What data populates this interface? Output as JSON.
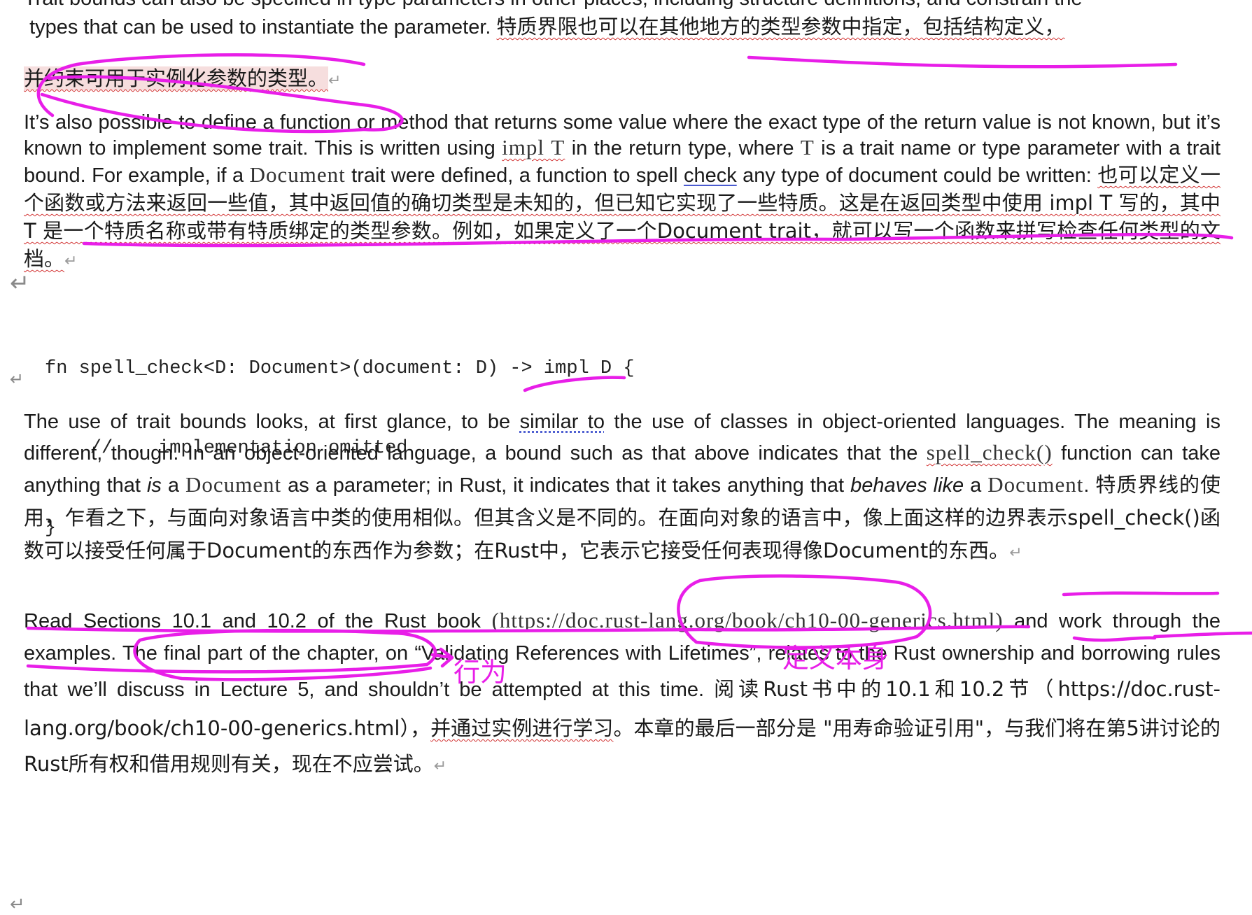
{
  "p1": {
    "line_top": "Trait bounds can also be specified in type parameters in other places, including structure definitions, and constrain the",
    "line_en": "types that can be used to instantiate the parameter. ",
    "zh_a": "特质界限也可以在其他地方的类型参数中指定，包括结构定义，",
    "zh_b": "并约束可用于实例化参数的类型。"
  },
  "p2": {
    "t1": "It’s also possible to define a function or method that returns some value where the exact type of the return value is not known, but it’s known to implement some trait. This is written using ",
    "impl_t": "impl T",
    "t2": " in the return type, where ",
    "t_code": "T",
    "t3": " is a trait name or type parameter with a trait bound. For example, if a ",
    "doc_code": "Document",
    "t4": " trait were defined, a function to spell ",
    "check_word": "check",
    "t5": " any type of document could be written: ",
    "zh": "也可以定义一个函数或方法来返回一些值，其中返回值的确切类型是未知的，但已知它实现了一些特质。这是在返回类型中使用 impl T 写的，其中 T 是一个特质名称或带有特质绑定的类型参数。例如，如果定义了一个Document trait，就可以写一个函数来拼写检查任何类型的文档。"
  },
  "code": {
    "line1": "fn spell_check<D: Document>(document: D) -> impl D {",
    "line2": "    // .. implementation omitted",
    "line3": "}"
  },
  "p3": {
    "t1": "The use of trait bounds looks, at first glance, to be ",
    "similar_to": "similar to",
    "t2": " the use of classes in object-oriented languages. The meaning is different, though. In an object-oriented language, a bound such as that above indicates that the ",
    "spell_code": "spell_check()",
    "t3": " function can take anything that ",
    "is_word": "is",
    "t4": " a ",
    "doc_code": "Document",
    "t5": " as a parameter; in Rust, it indicates that it takes anything that ",
    "behaves_like": "behaves like",
    "t6": " a ",
    "t7": ". ",
    "zh": "特质界线的使用，乍看之下，与面向对象语言中类的使用相似。但其含义是不同的。在面向对象的语言中，像上面这样的边界表示spell_check()函数可以接受任何属于Document的东西作为参数；在Rust中，它表示它接受任何表现得像Document的东西。"
  },
  "p4": {
    "t1": "Read Sections 10.1 and 10.2 of the Rust ",
    "book": "book",
    "url": "(https://doc.rust-lang.org/book/ch10-00-generics.html)",
    "t2": " and work through the examples. The final part of the chapter, on “Validating References with Lifetimes”, relates to the Rust ownership and borrowing rules that we’ll discuss in Lecture 5, and shouldn’t be attempted at this time. ",
    "zh_a": "阅读Rust书中的10.1和10.2节（https://doc.rust-lang.org/book/ch10-00-generics.html），",
    "zh_b": "并通过实例进行学习",
    "zh_c": "。本章的最后一部分是 \"用寿命验证引用\"，与我们将在第5讲讨论的Rust所有权和借用规则有关，现在不应尝试。"
  },
  "annotations": {
    "behavior": "行为",
    "definition_itself": "定义本身"
  },
  "marks": {
    "paragraph": "↵"
  },
  "colors": {
    "ink": "#e81ee8",
    "spell_squiggle": "#d23232",
    "link_underline": "#4a5bd0"
  }
}
